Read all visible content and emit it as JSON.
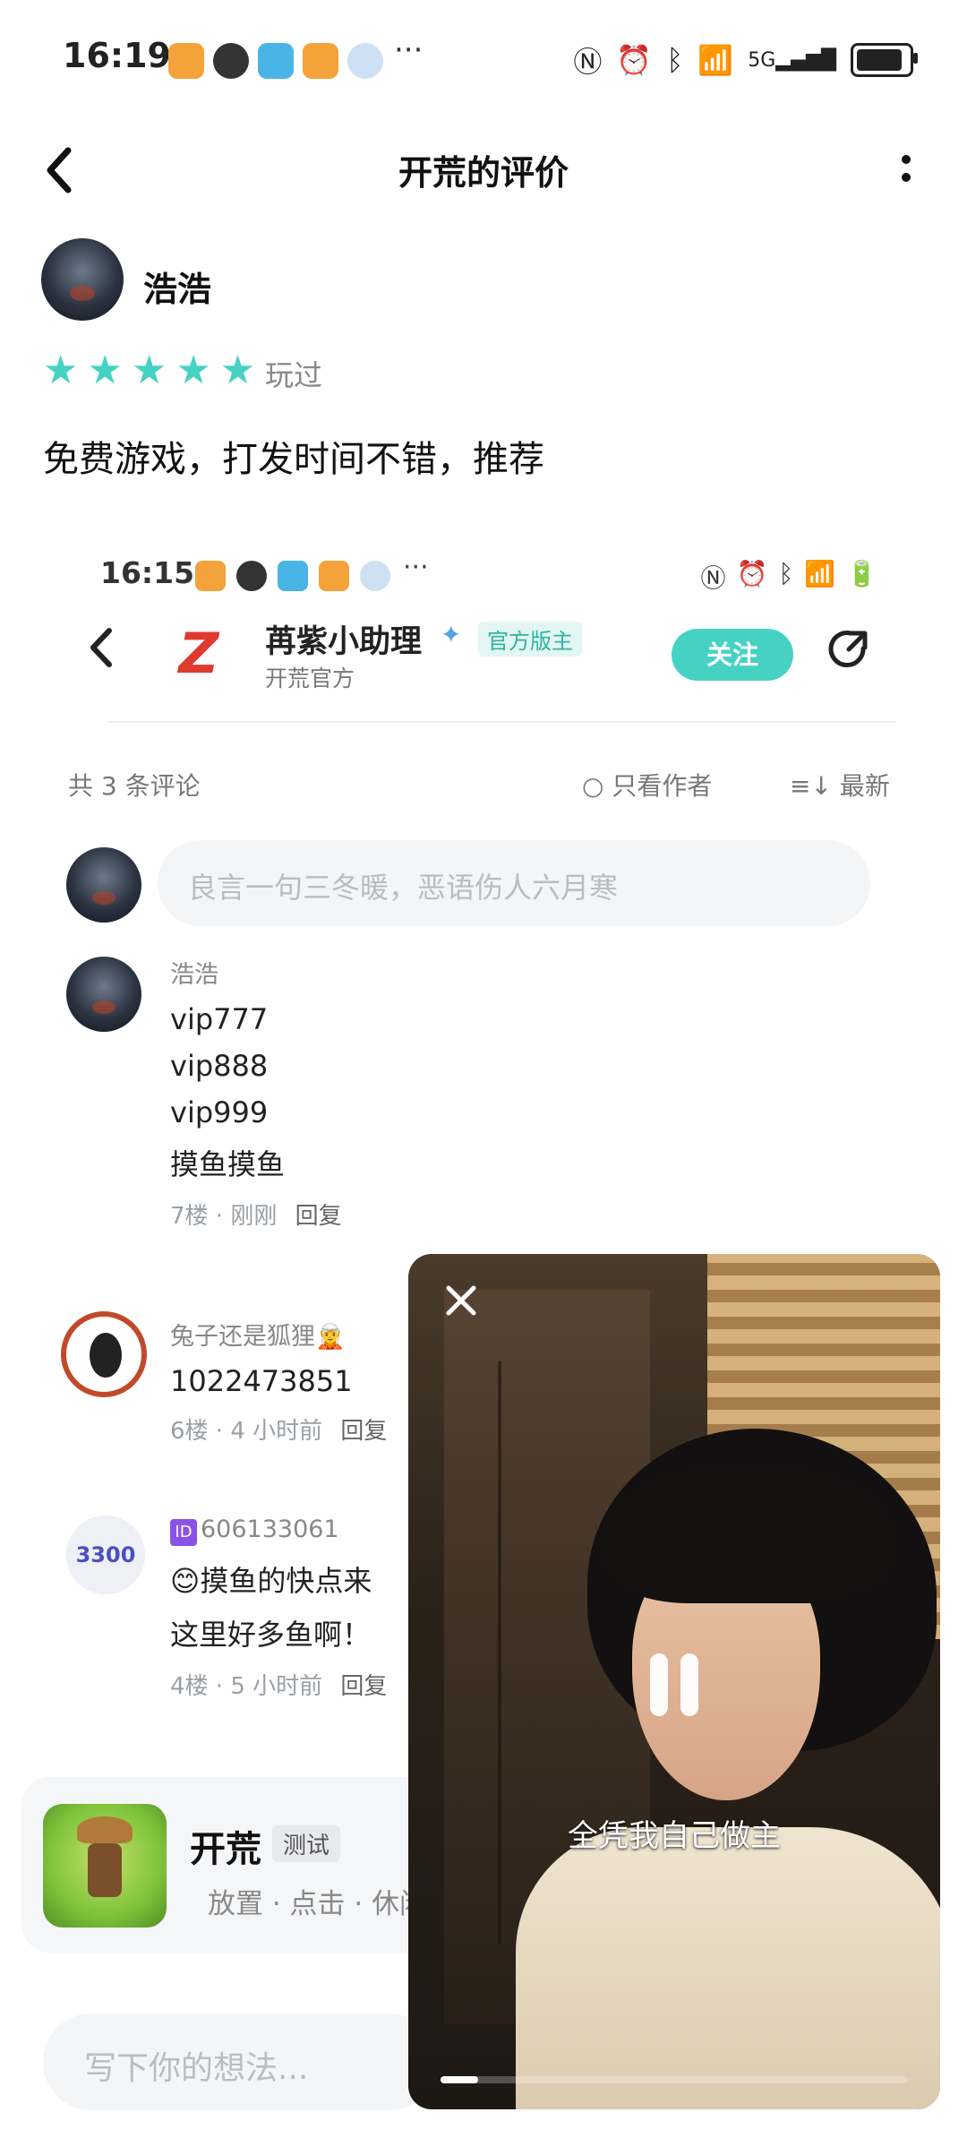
{
  "status_bar": {
    "time": "16:19",
    "overflow": "···",
    "icons": [
      "nfc-icon",
      "alarm-icon",
      "bluetooth-icon",
      "wifi-icon",
      "5g-signal-icon",
      "battery-icon"
    ]
  },
  "header": {
    "title": "开荒的评价"
  },
  "review": {
    "author": "浩浩",
    "rating": 5,
    "stars": [
      "★",
      "★",
      "★",
      "★",
      "★"
    ],
    "played_label": "玩过",
    "text": "免费游戏，打发时间不错，推荐"
  },
  "embedded": {
    "time": "16:15",
    "overflow": "···",
    "publisher_name": "苒紫小助理",
    "official_badge": "官方版主",
    "publisher_sub": "开荒官方",
    "follow_label": "关注",
    "comment_count": "共 3 条评论",
    "only_author": "○ 只看作者",
    "latest": "≡↓ 最新",
    "input_placeholder": "良言一句三冬暖，恶语伤人六月寒",
    "comments": [
      {
        "user": "浩浩",
        "lines": [
          "vip777",
          "vip888",
          "vip999",
          "摸鱼摸鱼"
        ],
        "meta": "7楼 · 刚刚",
        "reply": "回复"
      },
      {
        "user": "兔子还是狐狸🧝",
        "lines": [
          "1022473851"
        ],
        "meta": "6楼 · 4 小时前",
        "reply": "回复"
      },
      {
        "user": "606133061",
        "id_badge": "ID",
        "avatar_text": "3300",
        "lines": [
          "😊摸鱼的快点来",
          "这里好多鱼啊！"
        ],
        "meta": "4楼 · 5 小时前",
        "reply": "回复"
      }
    ]
  },
  "game_card": {
    "name": "开荒",
    "tag": "测试",
    "genres": "放置 · 点击 · 休闲"
  },
  "composer": {
    "placeholder": "写下你的想法..."
  },
  "video": {
    "subtitle": "全凭我自己做主",
    "progress": 0.08
  },
  "colors": {
    "accent": "#45d2c2",
    "star": "#45d2c2",
    "logo_red": "#e03a2f"
  }
}
